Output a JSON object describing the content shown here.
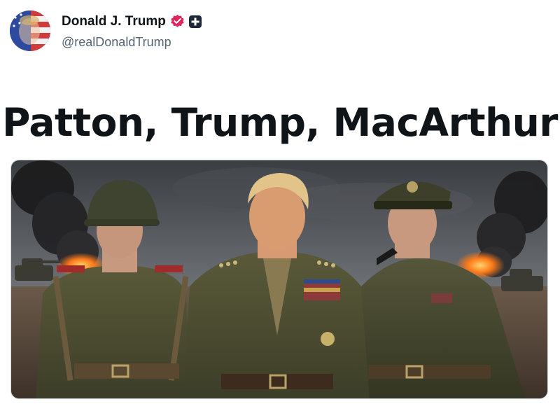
{
  "author": {
    "display_name": "Donald J. Trump",
    "handle": "@realDonaldTrump",
    "avatar_icon": "flag-portrait-avatar",
    "verified_icon": "verified-badge-icon",
    "verified_color": "#e0245e",
    "affiliate_icon": "plus-square-icon"
  },
  "post": {
    "text": "Patton, Trump, MacArthur"
  },
  "media": {
    "kind": "image",
    "subject_icons": [
      "soldier-helmet-figure",
      "general-figure",
      "officer-cap-pipe-figure"
    ]
  }
}
